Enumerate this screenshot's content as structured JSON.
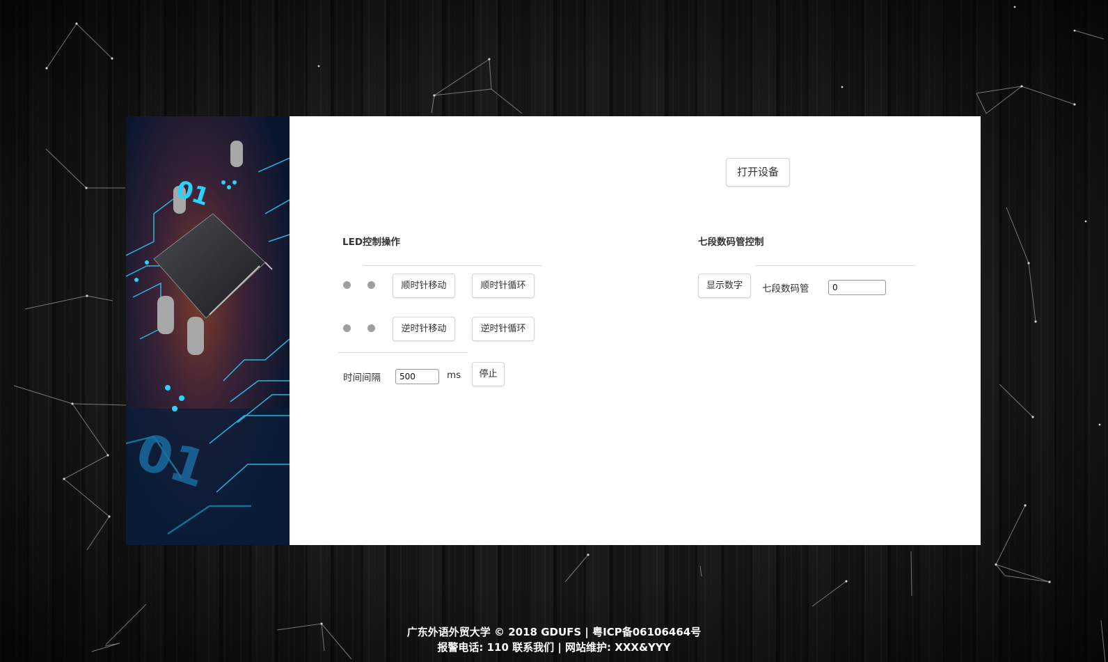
{
  "header": {
    "open_device_label": "打开设备"
  },
  "led_section": {
    "title": "LED控制操作",
    "clockwise_move_label": "顺时针移动",
    "clockwise_loop_label": "顺时针循环",
    "counterclockwise_move_label": "逆时针移动",
    "counterclockwise_loop_label": "逆时针循环",
    "interval_label": "时间间隔",
    "interval_value": "500",
    "unit_label": "ms",
    "stop_label": "停止",
    "led_color": "#9e9e9e"
  },
  "seven_seg_section": {
    "title": "七段数码管控制",
    "show_digit_label": "显示数字",
    "field_label": "七段数码管",
    "field_value": "0"
  },
  "side_image": {
    "text_top": "01",
    "text_bottom": "01",
    "accent_color": "#29d3ff"
  },
  "footer": {
    "line1": "广东外语外贸大学 © 2018 GDUFS | 粤ICP备06106464号",
    "line2": "报警电话: 110 联系我们 | 网站维护: XXX&YYY"
  },
  "colors": {
    "page_background": "#121212",
    "card_background": "#ffffff"
  }
}
